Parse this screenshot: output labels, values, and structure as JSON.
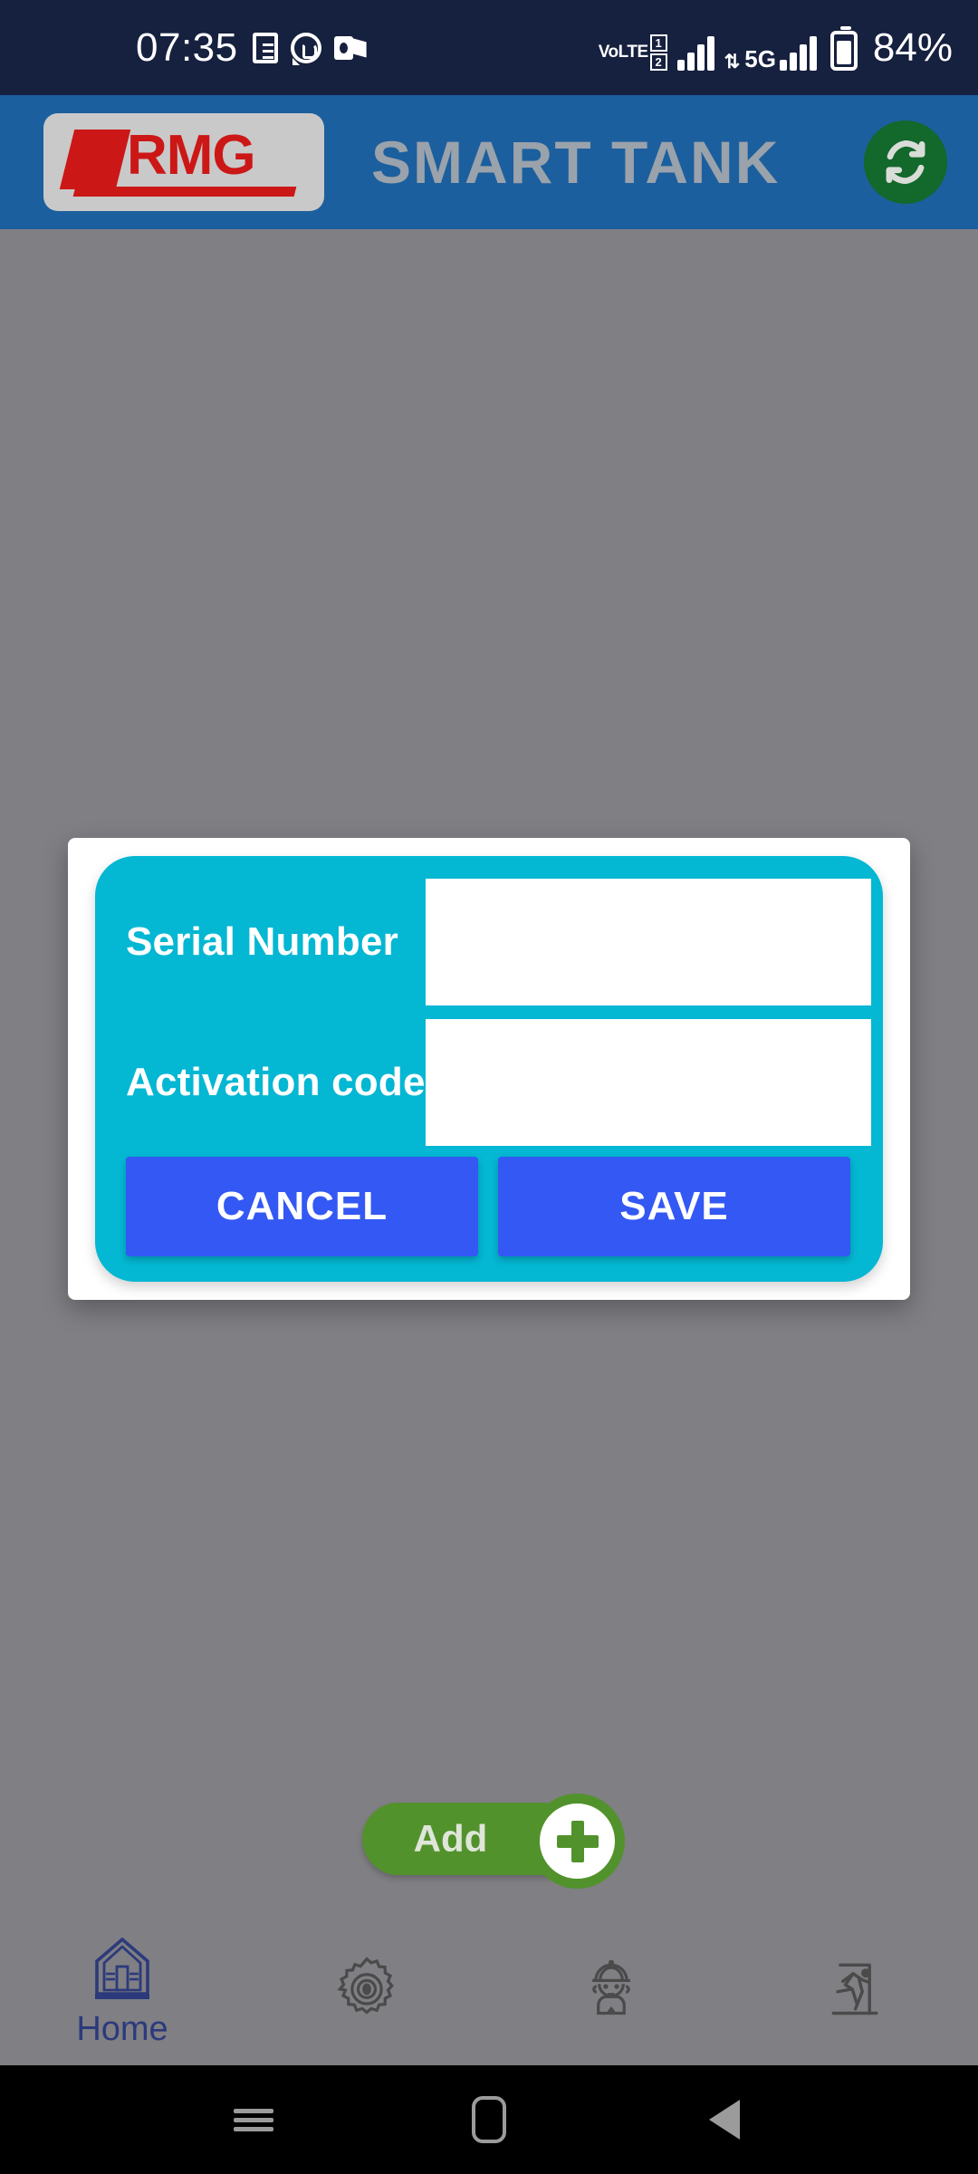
{
  "status_bar": {
    "time": "07:35",
    "notification_icons": [
      "note-icon",
      "whatsapp-icon",
      "outlook-icon"
    ],
    "network_label": "VoLTE",
    "sim1": "1",
    "sim2": "2",
    "data_type": "5G",
    "battery_percent": "84%",
    "background_color": "#16203f"
  },
  "app_bar": {
    "logo_text": "RMG",
    "title": "SMART TANK",
    "refresh_icon": "refresh-icon",
    "background_color": "#1c5f9e",
    "title_color": "#9aa2ab"
  },
  "dialog": {
    "fields": [
      {
        "label": "Serial Number",
        "value": "",
        "placeholder": ""
      },
      {
        "label": "Activation code",
        "value": "",
        "placeholder": ""
      }
    ],
    "cancel_label": "CANCEL",
    "save_label": "SAVE",
    "panel_color": "#04b7d3",
    "button_color": "#3358f4"
  },
  "add_button": {
    "label": "Add",
    "icon": "plus-circle-icon",
    "color": "#52922c"
  },
  "bottom_nav": {
    "items": [
      {
        "label": "Home",
        "icon": "home-tank-icon",
        "active": true
      },
      {
        "label": "",
        "icon": "gear-icon",
        "active": false
      },
      {
        "label": "",
        "icon": "technician-icon",
        "active": false
      },
      {
        "label": "",
        "icon": "exit-icon",
        "active": false
      }
    ],
    "active_color": "#2c3a7b",
    "inactive_color": "#4a4a4a"
  },
  "android_nav": {
    "recents": "recents-icon",
    "home": "home-icon",
    "back": "back-icon"
  }
}
